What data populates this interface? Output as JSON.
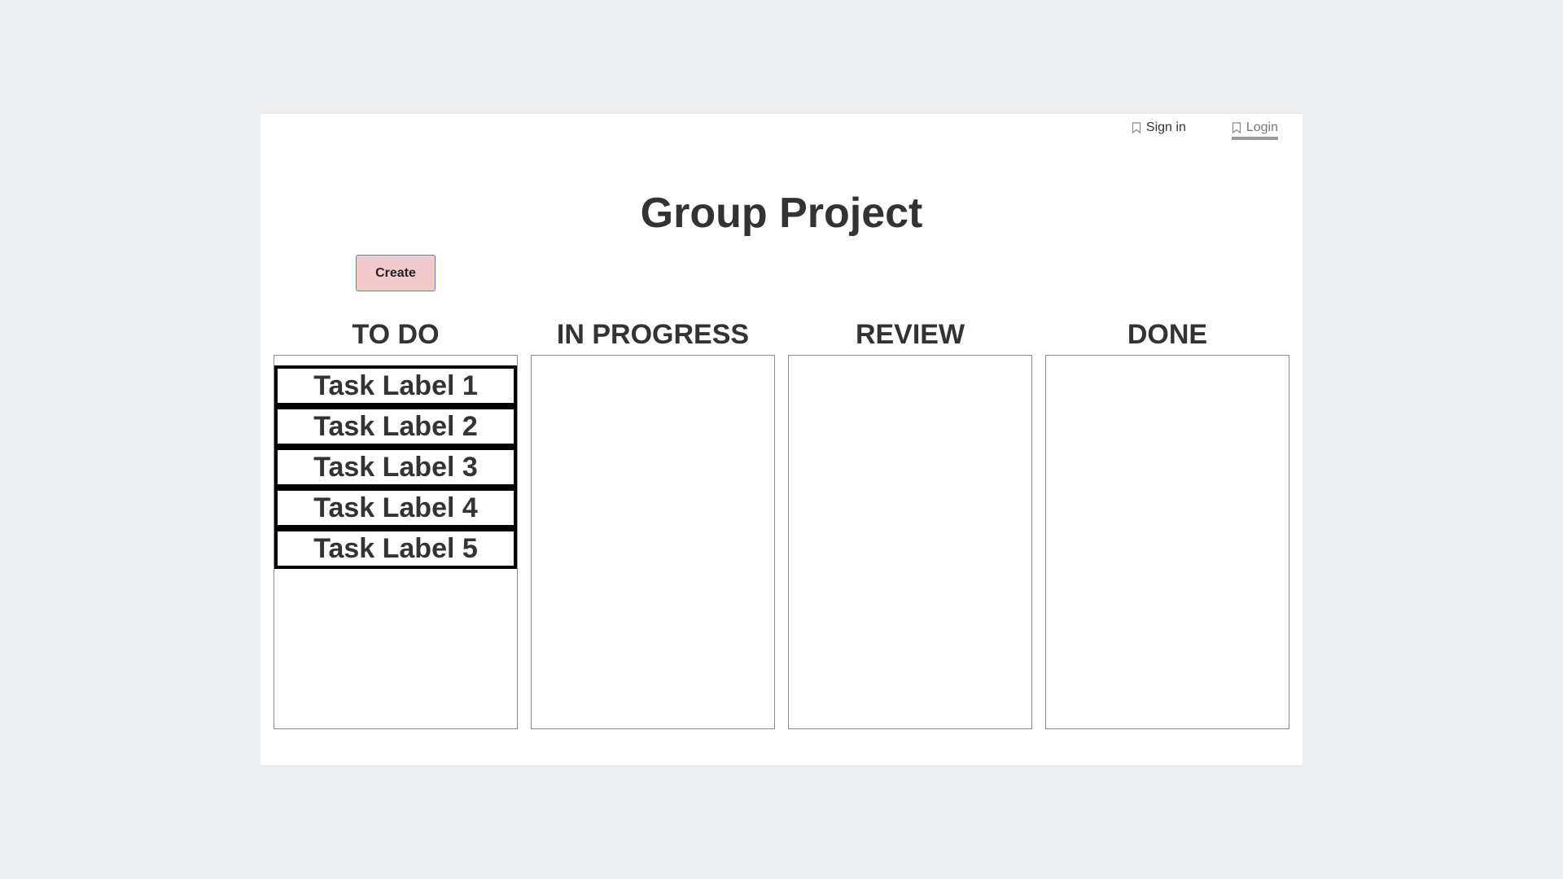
{
  "nav": {
    "sign_in": "Sign in",
    "login": "Login"
  },
  "page_title": "Group Project",
  "create_label": "Create",
  "columns": [
    {
      "title": "TO DO",
      "tasks": [
        "Task Label 1",
        "Task Label 2",
        "Task Label 3",
        "Task Label 4",
        "Task Label 5"
      ]
    },
    {
      "title": "IN PROGRESS",
      "tasks": []
    },
    {
      "title": "REVIEW",
      "tasks": []
    },
    {
      "title": "DONE",
      "tasks": []
    }
  ],
  "colors": {
    "background": "#eceef0",
    "create_button": "#f2cccc",
    "create_border": "#5a7fd0"
  },
  "icons": {
    "nav": "bookmark-icon"
  }
}
